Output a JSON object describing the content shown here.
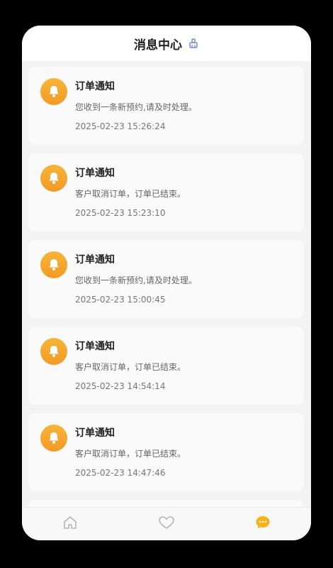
{
  "header": {
    "title": "消息中心",
    "clean_icon": "broom-icon"
  },
  "notifications": [
    {
      "title": "订单通知",
      "message": "您收到一条新预约,请及时处理。",
      "time": "2025-02-23 15:26:24",
      "icon": "bell-icon"
    },
    {
      "title": "订单通知",
      "message": "客户取消订单，订单已结束。",
      "time": "2025-02-23 15:23:10",
      "icon": "bell-icon"
    },
    {
      "title": "订单通知",
      "message": "您收到一条新预约,请及时处理。",
      "time": "2025-02-23 15:00:45",
      "icon": "bell-icon"
    },
    {
      "title": "订单通知",
      "message": "客户取消订单，订单已结束。",
      "time": "2025-02-23 14:54:14",
      "icon": "bell-icon"
    },
    {
      "title": "订单通知",
      "message": "客户取消订单，订单已结束。",
      "time": "2025-02-23 14:47:46",
      "icon": "bell-icon"
    }
  ],
  "tabbar": [
    {
      "name": "home",
      "icon": "home-icon",
      "active": false
    },
    {
      "name": "favorites",
      "icon": "heart-icon",
      "active": false
    },
    {
      "name": "messages",
      "icon": "chat-icon",
      "active": true
    }
  ],
  "colors": {
    "accent": "#f5a623",
    "active_tab": "#f5b21a",
    "inactive_tab": "#b5b5b5"
  }
}
